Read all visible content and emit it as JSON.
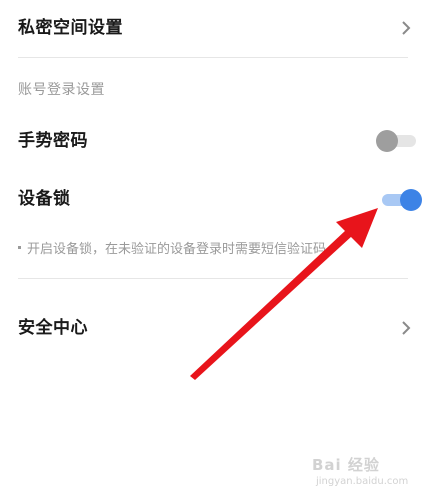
{
  "settings": {
    "private_space": {
      "label": "私密空间设置"
    },
    "section_account": "账号登录设置",
    "gesture_password": {
      "label": "手势密码",
      "enabled": false
    },
    "device_lock": {
      "label": "设备锁",
      "enabled": true
    },
    "device_lock_hint": "开启设备锁，在未验证的设备登录时需要短信验证码",
    "security_center": {
      "label": "安全中心"
    }
  },
  "watermark": {
    "brand": "Bai 经验",
    "url": "jingyan.baidu.com"
  },
  "colors": {
    "toggle_on": "#3d83e6",
    "toggle_off": "#9e9e9e",
    "annotation_arrow": "#e8141b"
  }
}
